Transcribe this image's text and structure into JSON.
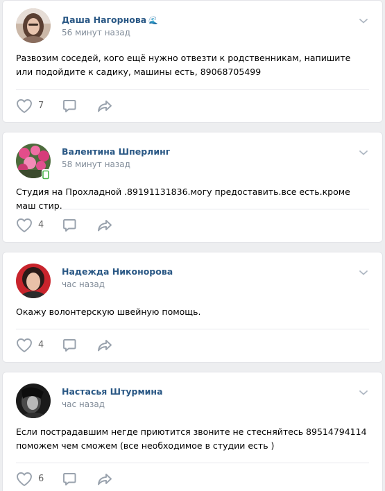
{
  "posts": [
    {
      "author": "Даша Нагорнова",
      "author_emoji": "🌊",
      "time": "56 минут назад",
      "text": "Развозим соседей, кого ещё нужно отвезти к родственникам, напишите или подойдите к садику, машины есть, 89068705499",
      "likes": "7",
      "online_mobile": false,
      "avatar": "young-woman-portrait"
    },
    {
      "author": "Валентина Шперлинг",
      "author_emoji": "",
      "time": "58 минут назад",
      "text": "Студия на Прохладной .89191131836.могу предоставить.все есть.кроме маш стир.",
      "likes": "4",
      "online_mobile": true,
      "avatar": "pink-flowers"
    },
    {
      "author": "Надежда Никонорова",
      "author_emoji": "",
      "time": "час назад",
      "text": "Окажу волонтерскую швейную помощь.",
      "likes": "4",
      "online_mobile": false,
      "avatar": "woman-red-background"
    },
    {
      "author": "Настасья Штурмина",
      "author_emoji": "",
      "time": "час назад",
      "text": "Если пострадавшим негде приютится звоните не стесняйтесь 89514794114 поможем чем сможем (все необходимое в студии есть )",
      "likes": "6",
      "online_mobile": false,
      "avatar": "black-and-white-portrait"
    }
  ],
  "colors": {
    "author_link": "#2a5885",
    "meta_text": "#818c99",
    "icon": "#99a2ad",
    "background": "#edeef0",
    "online_badge": "#4bb34b"
  },
  "icons": {
    "like": "heart-outline-icon",
    "comment": "speech-bubble-icon",
    "share": "share-arrow-icon",
    "menu": "chevron-down-icon"
  }
}
